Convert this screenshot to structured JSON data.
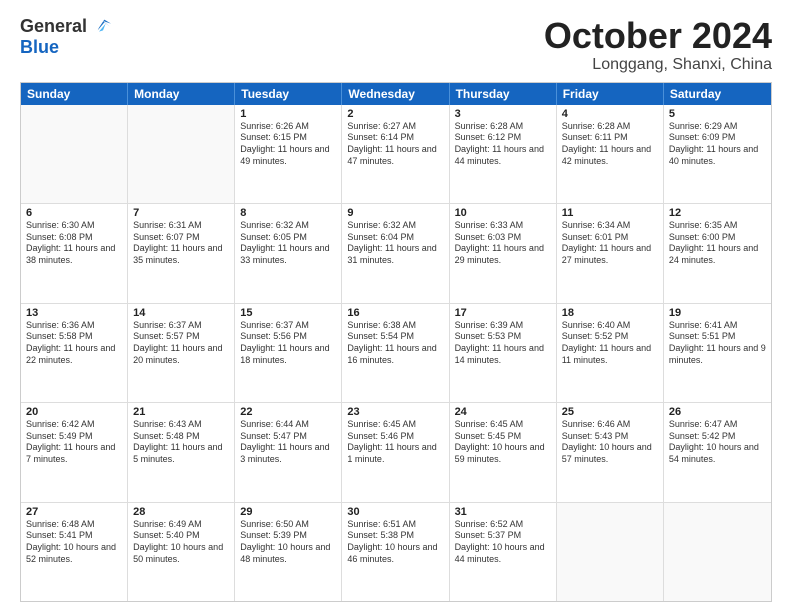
{
  "logo": {
    "general": "General",
    "blue": "Blue"
  },
  "title": "October 2024",
  "location": "Longgang, Shanxi, China",
  "header_days": [
    "Sunday",
    "Monday",
    "Tuesday",
    "Wednesday",
    "Thursday",
    "Friday",
    "Saturday"
  ],
  "weeks": [
    [
      {
        "day": "",
        "sunrise": "",
        "sunset": "",
        "daylight": ""
      },
      {
        "day": "",
        "sunrise": "",
        "sunset": "",
        "daylight": ""
      },
      {
        "day": "1",
        "sunrise": "Sunrise: 6:26 AM",
        "sunset": "Sunset: 6:15 PM",
        "daylight": "Daylight: 11 hours and 49 minutes."
      },
      {
        "day": "2",
        "sunrise": "Sunrise: 6:27 AM",
        "sunset": "Sunset: 6:14 PM",
        "daylight": "Daylight: 11 hours and 47 minutes."
      },
      {
        "day": "3",
        "sunrise": "Sunrise: 6:28 AM",
        "sunset": "Sunset: 6:12 PM",
        "daylight": "Daylight: 11 hours and 44 minutes."
      },
      {
        "day": "4",
        "sunrise": "Sunrise: 6:28 AM",
        "sunset": "Sunset: 6:11 PM",
        "daylight": "Daylight: 11 hours and 42 minutes."
      },
      {
        "day": "5",
        "sunrise": "Sunrise: 6:29 AM",
        "sunset": "Sunset: 6:09 PM",
        "daylight": "Daylight: 11 hours and 40 minutes."
      }
    ],
    [
      {
        "day": "6",
        "sunrise": "Sunrise: 6:30 AM",
        "sunset": "Sunset: 6:08 PM",
        "daylight": "Daylight: 11 hours and 38 minutes."
      },
      {
        "day": "7",
        "sunrise": "Sunrise: 6:31 AM",
        "sunset": "Sunset: 6:07 PM",
        "daylight": "Daylight: 11 hours and 35 minutes."
      },
      {
        "day": "8",
        "sunrise": "Sunrise: 6:32 AM",
        "sunset": "Sunset: 6:05 PM",
        "daylight": "Daylight: 11 hours and 33 minutes."
      },
      {
        "day": "9",
        "sunrise": "Sunrise: 6:32 AM",
        "sunset": "Sunset: 6:04 PM",
        "daylight": "Daylight: 11 hours and 31 minutes."
      },
      {
        "day": "10",
        "sunrise": "Sunrise: 6:33 AM",
        "sunset": "Sunset: 6:03 PM",
        "daylight": "Daylight: 11 hours and 29 minutes."
      },
      {
        "day": "11",
        "sunrise": "Sunrise: 6:34 AM",
        "sunset": "Sunset: 6:01 PM",
        "daylight": "Daylight: 11 hours and 27 minutes."
      },
      {
        "day": "12",
        "sunrise": "Sunrise: 6:35 AM",
        "sunset": "Sunset: 6:00 PM",
        "daylight": "Daylight: 11 hours and 24 minutes."
      }
    ],
    [
      {
        "day": "13",
        "sunrise": "Sunrise: 6:36 AM",
        "sunset": "Sunset: 5:58 PM",
        "daylight": "Daylight: 11 hours and 22 minutes."
      },
      {
        "day": "14",
        "sunrise": "Sunrise: 6:37 AM",
        "sunset": "Sunset: 5:57 PM",
        "daylight": "Daylight: 11 hours and 20 minutes."
      },
      {
        "day": "15",
        "sunrise": "Sunrise: 6:37 AM",
        "sunset": "Sunset: 5:56 PM",
        "daylight": "Daylight: 11 hours and 18 minutes."
      },
      {
        "day": "16",
        "sunrise": "Sunrise: 6:38 AM",
        "sunset": "Sunset: 5:54 PM",
        "daylight": "Daylight: 11 hours and 16 minutes."
      },
      {
        "day": "17",
        "sunrise": "Sunrise: 6:39 AM",
        "sunset": "Sunset: 5:53 PM",
        "daylight": "Daylight: 11 hours and 14 minutes."
      },
      {
        "day": "18",
        "sunrise": "Sunrise: 6:40 AM",
        "sunset": "Sunset: 5:52 PM",
        "daylight": "Daylight: 11 hours and 11 minutes."
      },
      {
        "day": "19",
        "sunrise": "Sunrise: 6:41 AM",
        "sunset": "Sunset: 5:51 PM",
        "daylight": "Daylight: 11 hours and 9 minutes."
      }
    ],
    [
      {
        "day": "20",
        "sunrise": "Sunrise: 6:42 AM",
        "sunset": "Sunset: 5:49 PM",
        "daylight": "Daylight: 11 hours and 7 minutes."
      },
      {
        "day": "21",
        "sunrise": "Sunrise: 6:43 AM",
        "sunset": "Sunset: 5:48 PM",
        "daylight": "Daylight: 11 hours and 5 minutes."
      },
      {
        "day": "22",
        "sunrise": "Sunrise: 6:44 AM",
        "sunset": "Sunset: 5:47 PM",
        "daylight": "Daylight: 11 hours and 3 minutes."
      },
      {
        "day": "23",
        "sunrise": "Sunrise: 6:45 AM",
        "sunset": "Sunset: 5:46 PM",
        "daylight": "Daylight: 11 hours and 1 minute."
      },
      {
        "day": "24",
        "sunrise": "Sunrise: 6:45 AM",
        "sunset": "Sunset: 5:45 PM",
        "daylight": "Daylight: 10 hours and 59 minutes."
      },
      {
        "day": "25",
        "sunrise": "Sunrise: 6:46 AM",
        "sunset": "Sunset: 5:43 PM",
        "daylight": "Daylight: 10 hours and 57 minutes."
      },
      {
        "day": "26",
        "sunrise": "Sunrise: 6:47 AM",
        "sunset": "Sunset: 5:42 PM",
        "daylight": "Daylight: 10 hours and 54 minutes."
      }
    ],
    [
      {
        "day": "27",
        "sunrise": "Sunrise: 6:48 AM",
        "sunset": "Sunset: 5:41 PM",
        "daylight": "Daylight: 10 hours and 52 minutes."
      },
      {
        "day": "28",
        "sunrise": "Sunrise: 6:49 AM",
        "sunset": "Sunset: 5:40 PM",
        "daylight": "Daylight: 10 hours and 50 minutes."
      },
      {
        "day": "29",
        "sunrise": "Sunrise: 6:50 AM",
        "sunset": "Sunset: 5:39 PM",
        "daylight": "Daylight: 10 hours and 48 minutes."
      },
      {
        "day": "30",
        "sunrise": "Sunrise: 6:51 AM",
        "sunset": "Sunset: 5:38 PM",
        "daylight": "Daylight: 10 hours and 46 minutes."
      },
      {
        "day": "31",
        "sunrise": "Sunrise: 6:52 AM",
        "sunset": "Sunset: 5:37 PM",
        "daylight": "Daylight: 10 hours and 44 minutes."
      },
      {
        "day": "",
        "sunrise": "",
        "sunset": "",
        "daylight": ""
      },
      {
        "day": "",
        "sunrise": "",
        "sunset": "",
        "daylight": ""
      }
    ]
  ]
}
